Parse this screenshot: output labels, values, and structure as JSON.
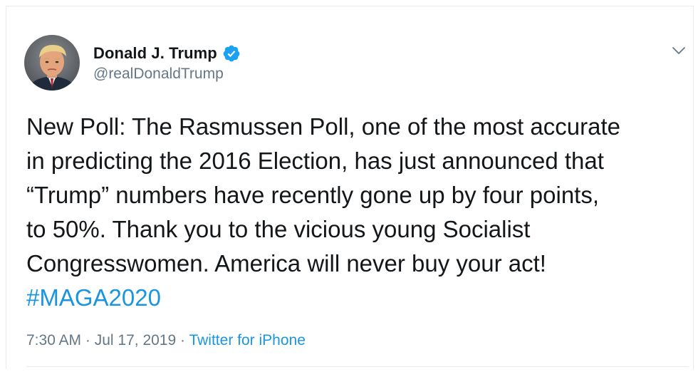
{
  "tweet": {
    "author": {
      "display_name": "Donald J. Trump",
      "handle": "@realDonaldTrump",
      "verified": true,
      "avatar": "profile-photo"
    },
    "text_lines": [
      "New Poll: The Rasmussen Poll, one of the most accurate",
      "in predicting the 2016 Election, has just announced that",
      "“Trump” numbers have recently gone up by four points,",
      "to 50%. Thank you to the vicious young Socialist",
      "Congresswomen. America will never buy your act!"
    ],
    "hashtag": "#MAGA2020",
    "time": "7:30 AM",
    "separator": " · ",
    "date": "Jul 17, 2019",
    "source": "Twitter for iPhone"
  },
  "icons": {
    "verified": "verified-badge-icon",
    "menu": "chevron-down-icon"
  },
  "colors": {
    "link": "#1b95e0",
    "secondary_text": "#657786",
    "primary_text": "#14171a",
    "border": "#e6ecf0"
  }
}
